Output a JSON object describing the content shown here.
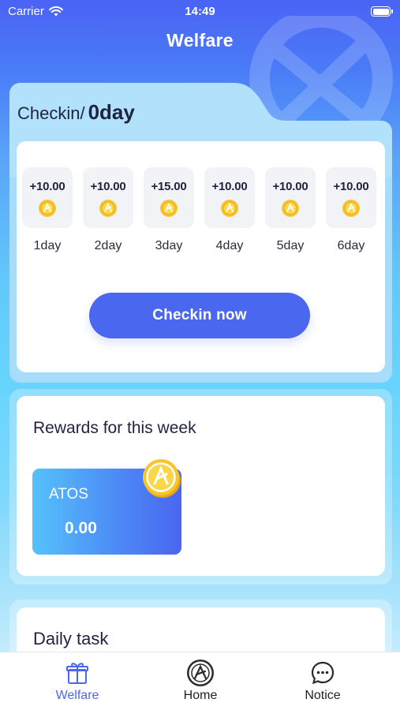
{
  "status_bar": {
    "carrier": "Carrier",
    "time": "14:49"
  },
  "page": {
    "title": "Welfare"
  },
  "checkin": {
    "title": "Checkin/",
    "days_count": "0day",
    "days": [
      {
        "amount": "+10.00",
        "label": "1day"
      },
      {
        "amount": "+10.00",
        "label": "2day"
      },
      {
        "amount": "+15.00",
        "label": "3day"
      },
      {
        "amount": "+10.00",
        "label": "4day"
      },
      {
        "amount": "+10.00",
        "label": "5day"
      },
      {
        "amount": "+10.00",
        "label": "6day"
      }
    ],
    "button_label": "Checkin now"
  },
  "rewards": {
    "title": "Rewards for this week",
    "token": "ATOS",
    "amount": "0.00"
  },
  "daily_task": {
    "title": "Daily task"
  },
  "tabbar": {
    "items": [
      {
        "label": "Welfare",
        "icon": "gift-icon",
        "active": true
      },
      {
        "label": "Home",
        "icon": "home-logo-icon",
        "active": false
      },
      {
        "label": "Notice",
        "icon": "chat-bubble-icon",
        "active": false
      }
    ]
  },
  "colors": {
    "accent": "#4a67ef",
    "coin": "#f7c62f",
    "text": "#1f2340"
  }
}
